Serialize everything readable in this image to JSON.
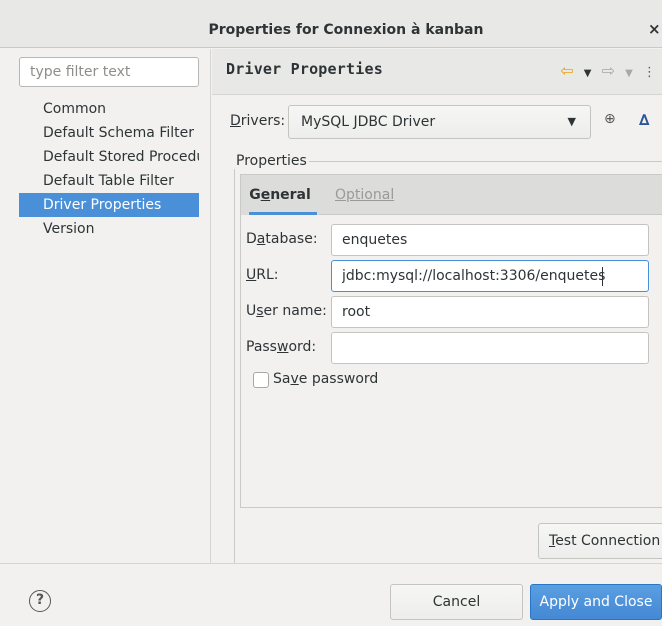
{
  "window": {
    "title": "Properties for Connexion à kanban",
    "close_glyph": "×"
  },
  "sidebar": {
    "filter_placeholder": "type filter text",
    "items": [
      {
        "label": "Common",
        "selected": false
      },
      {
        "label": "Default Schema Filter",
        "selected": false
      },
      {
        "label": "Default Stored Procedures",
        "selected": false
      },
      {
        "label": "Default Table Filter",
        "selected": false
      },
      {
        "label": "Driver Properties",
        "selected": true
      },
      {
        "label": "Version",
        "selected": false
      }
    ]
  },
  "page": {
    "title": "Driver Properties",
    "nav_icons": [
      "back-arrow-icon",
      "back-dropdown-icon",
      "forward-arrow-icon",
      "forward-dropdown-icon",
      "view-menu-icon"
    ]
  },
  "drivers": {
    "label_prefix": "",
    "label_mnemonic": "D",
    "label_rest": "rivers:",
    "selected": "MySQL JDBC Driver",
    "add_icon": "new-driver-icon",
    "edit_icon": "edit-driver-icon"
  },
  "properties": {
    "group_label": "Properties",
    "tabs": {
      "general": {
        "pre": "G",
        "mnemonic": "e",
        "post": "neral"
      },
      "optional": {
        "pre": "",
        "mnemonic": "O",
        "post": "ptional"
      }
    },
    "fields": {
      "database": {
        "pre": "D",
        "mnemonic": "a",
        "post": "tabase:",
        "value": "enquetes"
      },
      "url": {
        "pre": "",
        "mnemonic": "U",
        "post": "RL:",
        "value": "jdbc:mysql://localhost:3306/enquetes"
      },
      "username": {
        "pre": "U",
        "mnemonic": "s",
        "post": "er name:",
        "value": "root"
      },
      "password": {
        "pre": "Pass",
        "mnemonic": "w",
        "post": "ord:",
        "value": ""
      }
    },
    "save_password": {
      "pre": "Sa",
      "mnemonic": "v",
      "post": "e password",
      "checked": false
    }
  },
  "test_connection": {
    "pre": "",
    "mnemonic": "T",
    "post": "est Connection"
  },
  "footer": {
    "help_glyph": "?",
    "cancel_label": "Cancel",
    "apply_label": "Apply and Close"
  },
  "colors": {
    "accent": "#4a90d9",
    "back_arrow": "#e8a317",
    "delta_icon": "#2b5797"
  }
}
